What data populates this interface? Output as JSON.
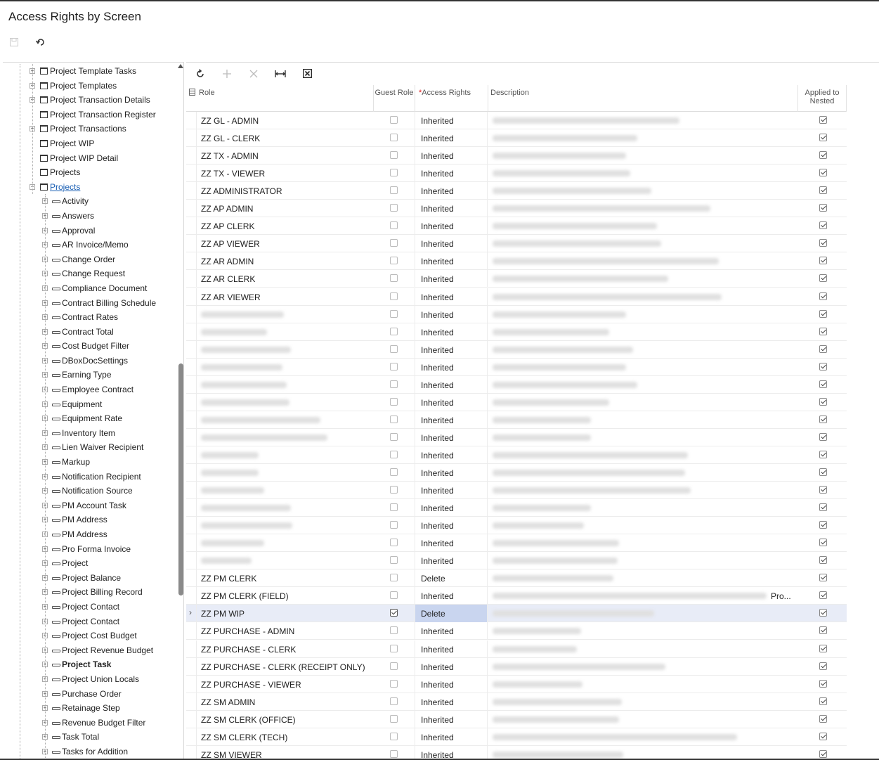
{
  "page": {
    "title": "Access Rights by Screen"
  },
  "toolbar": {
    "save_icon": "save-icon",
    "undo_icon": "undo-icon"
  },
  "tree": {
    "nodes": [
      {
        "label": "Project Template Tasks",
        "level": 1,
        "kind": "screen",
        "expandable": true
      },
      {
        "label": "Project Templates",
        "level": 1,
        "kind": "screen",
        "expandable": true
      },
      {
        "label": "Project Transaction Details",
        "level": 1,
        "kind": "screen",
        "expandable": true
      },
      {
        "label": "Project Transaction Register",
        "level": 1,
        "kind": "screen",
        "expandable": false
      },
      {
        "label": "Project Transactions",
        "level": 1,
        "kind": "screen",
        "expandable": true
      },
      {
        "label": "Project WIP",
        "level": 1,
        "kind": "screen",
        "expandable": false
      },
      {
        "label": "Project WIP Detail",
        "level": 1,
        "kind": "screen",
        "expandable": false
      },
      {
        "label": "Projects",
        "level": 1,
        "kind": "screen",
        "expandable": false
      },
      {
        "label": "Projects",
        "level": 1,
        "kind": "screen",
        "expandable": true,
        "link": true,
        "expanded": true
      },
      {
        "label": "Activity",
        "level": 2,
        "kind": "field",
        "expandable": true
      },
      {
        "label": "Answers",
        "level": 2,
        "kind": "field",
        "expandable": true
      },
      {
        "label": "Approval",
        "level": 2,
        "kind": "field",
        "expandable": true
      },
      {
        "label": "AR Invoice/Memo",
        "level": 2,
        "kind": "field",
        "expandable": true
      },
      {
        "label": "Change Order",
        "level": 2,
        "kind": "field",
        "expandable": true
      },
      {
        "label": "Change Request",
        "level": 2,
        "kind": "field",
        "expandable": true
      },
      {
        "label": "Compliance Document",
        "level": 2,
        "kind": "field",
        "expandable": true
      },
      {
        "label": "Contract Billing Schedule",
        "level": 2,
        "kind": "field",
        "expandable": true
      },
      {
        "label": "Contract Rates",
        "level": 2,
        "kind": "field",
        "expandable": true
      },
      {
        "label": "Contract Total",
        "level": 2,
        "kind": "field",
        "expandable": true
      },
      {
        "label": "Cost Budget Filter",
        "level": 2,
        "kind": "field",
        "expandable": true
      },
      {
        "label": "DBoxDocSettings",
        "level": 2,
        "kind": "field",
        "expandable": true
      },
      {
        "label": "Earning Type",
        "level": 2,
        "kind": "field",
        "expandable": true
      },
      {
        "label": "Employee Contract",
        "level": 2,
        "kind": "field",
        "expandable": true
      },
      {
        "label": "Equipment",
        "level": 2,
        "kind": "field",
        "expandable": true
      },
      {
        "label": "Equipment Rate",
        "level": 2,
        "kind": "field",
        "expandable": true
      },
      {
        "label": "Inventory Item",
        "level": 2,
        "kind": "field",
        "expandable": true
      },
      {
        "label": "Lien Waiver Recipient",
        "level": 2,
        "kind": "field",
        "expandable": true
      },
      {
        "label": "Markup",
        "level": 2,
        "kind": "field",
        "expandable": true
      },
      {
        "label": "Notification Recipient",
        "level": 2,
        "kind": "field",
        "expandable": true
      },
      {
        "label": "Notification Source",
        "level": 2,
        "kind": "field",
        "expandable": true
      },
      {
        "label": "PM Account Task",
        "level": 2,
        "kind": "field",
        "expandable": true
      },
      {
        "label": "PM Address",
        "level": 2,
        "kind": "field",
        "expandable": true
      },
      {
        "label": "PM Address",
        "level": 2,
        "kind": "field",
        "expandable": true
      },
      {
        "label": "Pro Forma Invoice",
        "level": 2,
        "kind": "field",
        "expandable": true
      },
      {
        "label": "Project",
        "level": 2,
        "kind": "field",
        "expandable": true
      },
      {
        "label": "Project Balance",
        "level": 2,
        "kind": "field",
        "expandable": true
      },
      {
        "label": "Project Billing Record",
        "level": 2,
        "kind": "field",
        "expandable": true
      },
      {
        "label": "Project Contact",
        "level": 2,
        "kind": "field",
        "expandable": true
      },
      {
        "label": "Project Contact",
        "level": 2,
        "kind": "field",
        "expandable": true
      },
      {
        "label": "Project Cost Budget",
        "level": 2,
        "kind": "field",
        "expandable": true
      },
      {
        "label": "Project Revenue Budget",
        "level": 2,
        "kind": "field",
        "expandable": true
      },
      {
        "label": "Project Task",
        "level": 2,
        "kind": "field",
        "expandable": true,
        "bold": true
      },
      {
        "label": "Project Union Locals",
        "level": 2,
        "kind": "field",
        "expandable": true
      },
      {
        "label": "Purchase Order",
        "level": 2,
        "kind": "field",
        "expandable": true
      },
      {
        "label": "Retainage Step",
        "level": 2,
        "kind": "field",
        "expandable": true
      },
      {
        "label": "Revenue Budget Filter",
        "level": 2,
        "kind": "field",
        "expandable": true
      },
      {
        "label": "Task Total",
        "level": 2,
        "kind": "field",
        "expandable": true
      },
      {
        "label": "Tasks for Addition",
        "level": 2,
        "kind": "field",
        "expandable": true
      }
    ]
  },
  "grid": {
    "toolbar": [
      "refresh-icon",
      "add-icon",
      "delete-icon",
      "fit-columns-icon",
      "export-excel-icon"
    ],
    "columns": {
      "role": "Role",
      "guest_role": "Guest Role",
      "access_rights": "Access Rights",
      "access_rights_required": "*",
      "description": "Description",
      "applied_to_nested": "Applied to Nested"
    },
    "rows": [
      {
        "role": "ZZ GL - ADMIN",
        "guest": false,
        "access": "Inherited",
        "nested": true,
        "role_blur": 0,
        "desc_blur": 266
      },
      {
        "role": "ZZ GL - CLERK",
        "guest": false,
        "access": "Inherited",
        "nested": true,
        "role_blur": 0,
        "desc_blur": 206
      },
      {
        "role": "ZZ TX - ADMIN",
        "guest": false,
        "access": "Inherited",
        "nested": true,
        "role_blur": 0,
        "desc_blur": 190
      },
      {
        "role": "ZZ TX - VIEWER",
        "guest": false,
        "access": "Inherited",
        "nested": true,
        "role_blur": 0,
        "desc_blur": 196
      },
      {
        "role": "ZZ ADMINISTRATOR",
        "guest": false,
        "access": "Inherited",
        "nested": true,
        "role_blur": 0,
        "desc_blur": 226
      },
      {
        "role": "ZZ AP ADMIN",
        "guest": false,
        "access": "Inherited",
        "nested": true,
        "role_blur": 0,
        "desc_blur": 310
      },
      {
        "role": "ZZ AP CLERK",
        "guest": false,
        "access": "Inherited",
        "nested": true,
        "role_blur": 0,
        "desc_blur": 234
      },
      {
        "role": "ZZ AP VIEWER",
        "guest": false,
        "access": "Inherited",
        "nested": true,
        "role_blur": 0,
        "desc_blur": 240
      },
      {
        "role": "ZZ AR ADMIN",
        "guest": false,
        "access": "Inherited",
        "nested": true,
        "role_blur": 0,
        "desc_blur": 322
      },
      {
        "role": "ZZ AR CLERK",
        "guest": false,
        "access": "Inherited",
        "nested": true,
        "role_blur": 0,
        "desc_blur": 250
      },
      {
        "role": "ZZ AR VIEWER",
        "guest": false,
        "access": "Inherited",
        "nested": true,
        "role_blur": 0,
        "desc_blur": 326
      },
      {
        "role": "",
        "guest": false,
        "access": "Inherited",
        "nested": true,
        "role_blur": 118,
        "desc_blur": 190
      },
      {
        "role": "",
        "guest": false,
        "access": "Inherited",
        "nested": true,
        "role_blur": 94,
        "desc_blur": 166
      },
      {
        "role": "",
        "guest": false,
        "access": "Inherited",
        "nested": true,
        "role_blur": 128,
        "desc_blur": 200
      },
      {
        "role": "",
        "guest": false,
        "access": "Inherited",
        "nested": true,
        "role_blur": 116,
        "desc_blur": 190
      },
      {
        "role": "",
        "guest": false,
        "access": "Inherited",
        "nested": true,
        "role_blur": 122,
        "desc_blur": 206
      },
      {
        "role": "",
        "guest": false,
        "access": "Inherited",
        "nested": true,
        "role_blur": 126,
        "desc_blur": 166
      },
      {
        "role": "",
        "guest": false,
        "access": "Inherited",
        "nested": true,
        "role_blur": 170,
        "desc_blur": 140
      },
      {
        "role": "",
        "guest": false,
        "access": "Inherited",
        "nested": true,
        "role_blur": 180,
        "desc_blur": 140
      },
      {
        "role": "",
        "guest": false,
        "access": "Inherited",
        "nested": true,
        "role_blur": 82,
        "desc_blur": 278
      },
      {
        "role": "",
        "guest": false,
        "access": "Inherited",
        "nested": true,
        "role_blur": 82,
        "desc_blur": 274
      },
      {
        "role": "",
        "guest": false,
        "access": "Inherited",
        "nested": true,
        "role_blur": 90,
        "desc_blur": 282
      },
      {
        "role": "",
        "guest": false,
        "access": "Inherited",
        "nested": true,
        "role_blur": 128,
        "desc_blur": 140
      },
      {
        "role": "",
        "guest": false,
        "access": "Inherited",
        "nested": true,
        "role_blur": 130,
        "desc_blur": 130
      },
      {
        "role": "",
        "guest": false,
        "access": "Inherited",
        "nested": true,
        "role_blur": 90,
        "desc_blur": 180
      },
      {
        "role": "",
        "guest": false,
        "access": "Inherited",
        "nested": true,
        "role_blur": 72,
        "desc_blur": 178
      },
      {
        "role": "ZZ PM CLERK",
        "guest": false,
        "access": "Delete",
        "nested": true,
        "role_blur": 0,
        "desc_blur": 172
      },
      {
        "role": "ZZ PM CLERK (FIELD)",
        "guest": false,
        "access": "Inherited",
        "nested": true,
        "role_blur": 0,
        "desc_blur": 390,
        "extra": "Pro..."
      },
      {
        "role": "ZZ PM WIP",
        "guest": true,
        "access": "Delete",
        "nested": true,
        "role_blur": 0,
        "desc_blur": 230,
        "selected": true
      },
      {
        "role": "ZZ PURCHASE - ADMIN",
        "guest": false,
        "access": "Inherited",
        "nested": true,
        "role_blur": 0,
        "desc_blur": 126
      },
      {
        "role": "ZZ PURCHASE - CLERK",
        "guest": false,
        "access": "Inherited",
        "nested": true,
        "role_blur": 0,
        "desc_blur": 120
      },
      {
        "role": "ZZ PURCHASE - CLERK (RECEIPT ONLY)",
        "guest": false,
        "access": "Inherited",
        "nested": true,
        "role_blur": 0,
        "desc_blur": 246
      },
      {
        "role": "ZZ PURCHASE - VIEWER",
        "guest": false,
        "access": "Inherited",
        "nested": true,
        "role_blur": 0,
        "desc_blur": 128
      },
      {
        "role": "ZZ SM ADMIN",
        "guest": false,
        "access": "Inherited",
        "nested": true,
        "role_blur": 0,
        "desc_blur": 184
      },
      {
        "role": "ZZ SM CLERK (OFFICE)",
        "guest": false,
        "access": "Inherited",
        "nested": true,
        "role_blur": 0,
        "desc_blur": 180
      },
      {
        "role": "ZZ SM CLERK (TECH)",
        "guest": false,
        "access": "Inherited",
        "nested": true,
        "role_blur": 0,
        "desc_blur": 348
      },
      {
        "role": "ZZ SM VIEWER",
        "guest": false,
        "access": "Inherited",
        "nested": true,
        "role_blur": 0,
        "desc_blur": 186
      }
    ]
  }
}
